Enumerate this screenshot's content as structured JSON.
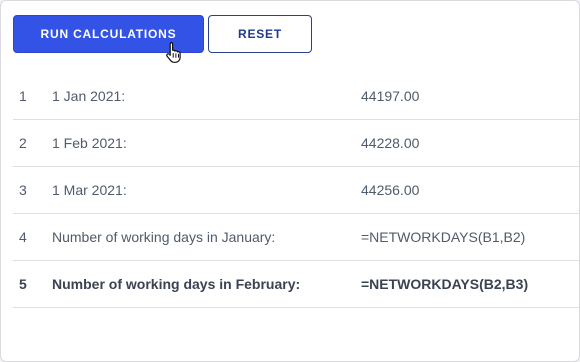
{
  "toolbar": {
    "run_label": "RUN CALCULATIONS",
    "reset_label": "RESET"
  },
  "rows": [
    {
      "num": "1",
      "label": "1 Jan 2021:",
      "value": "44197.00"
    },
    {
      "num": "2",
      "label": "1 Feb 2021:",
      "value": "44228.00"
    },
    {
      "num": "3",
      "label": "1 Mar 2021:",
      "value": "44256.00"
    },
    {
      "num": "4",
      "label": "Number of working days in January:",
      "value": "=NETWORKDAYS(B1,B2)"
    },
    {
      "num": "5",
      "label": "Number of working days in February:",
      "value": "=NETWORKDAYS(B2,B3)"
    }
  ],
  "icons": {
    "cursor": "hand-pointer-cursor"
  },
  "colors": {
    "primary": "#3353e6",
    "secondary_border": "#2b3f8f"
  }
}
